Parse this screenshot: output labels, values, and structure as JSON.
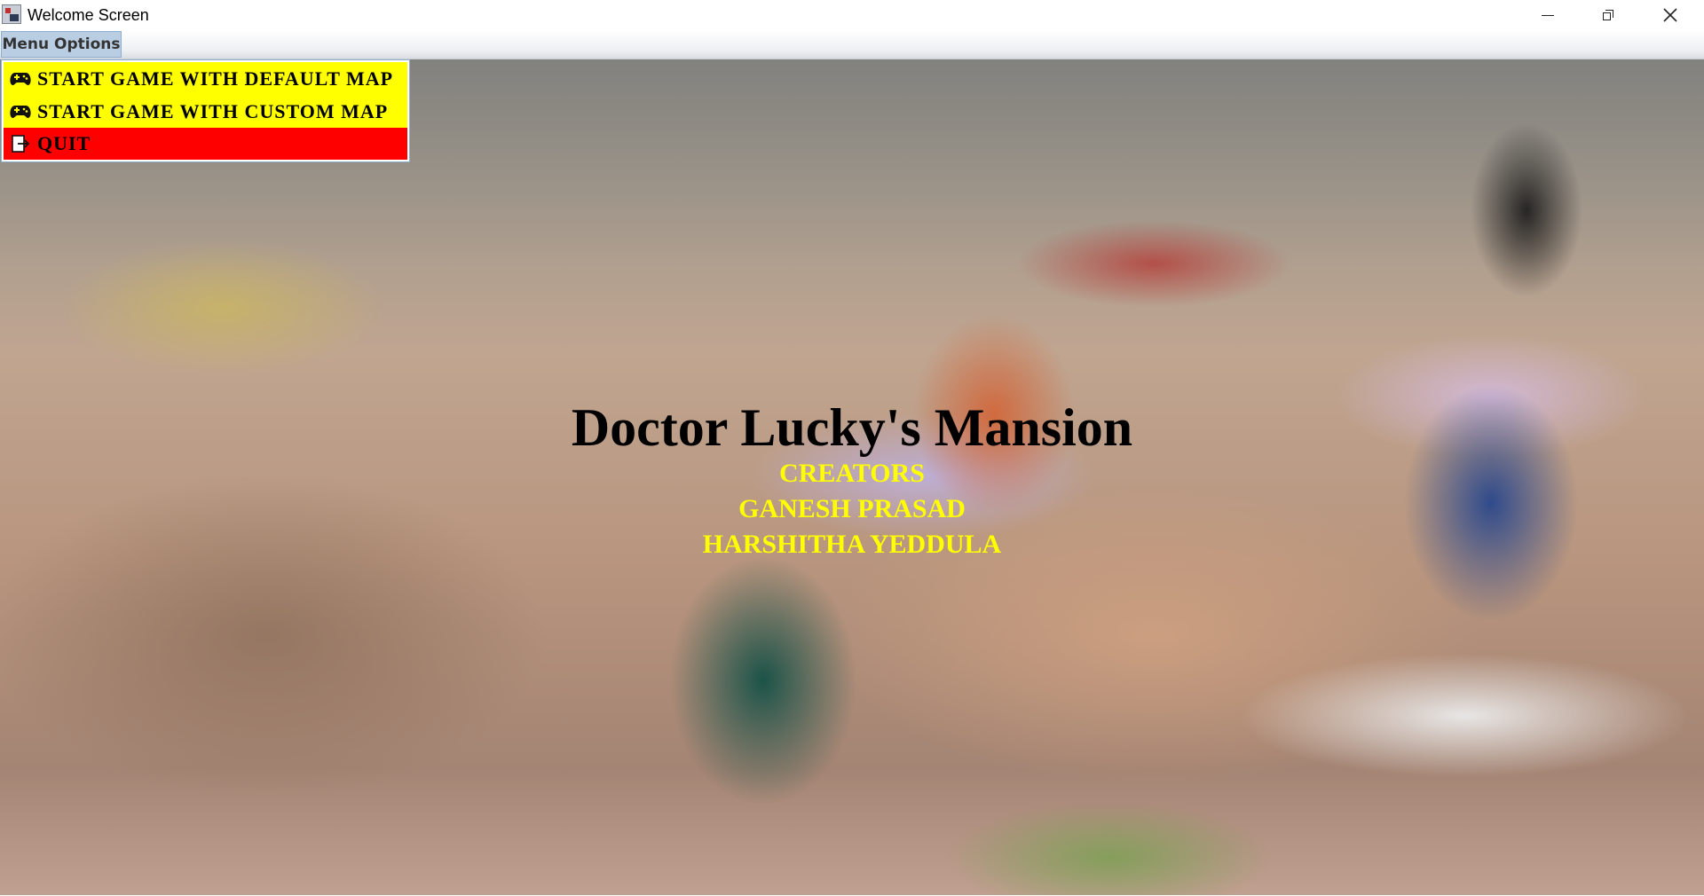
{
  "window": {
    "title": "Welcome Screen",
    "controls": {
      "minimize_icon": "minimize-icon",
      "maximize_icon": "restore-icon",
      "close_icon": "close-icon"
    }
  },
  "menubar": {
    "menu_label": "Menu Options"
  },
  "dropdown": {
    "items": [
      {
        "label": "START GAME WITH DEFAULT MAP",
        "icon": "gamepad-icon",
        "bg_color": "#ffff00"
      },
      {
        "label": "START GAME WITH CUSTOM MAP",
        "icon": "gamepad-icon",
        "bg_color": "#ffff00"
      },
      {
        "label": "QUIT",
        "icon": "exit-icon",
        "bg_color": "#ff0000"
      }
    ]
  },
  "main": {
    "game_title": "Doctor Lucky's Mansion",
    "credits_heading": "CREATORS",
    "creators": [
      "GANESH PRASAD",
      "HARSHITHA YEDDULA"
    ],
    "title_color": "#000000",
    "credits_color": "#ffff00"
  }
}
